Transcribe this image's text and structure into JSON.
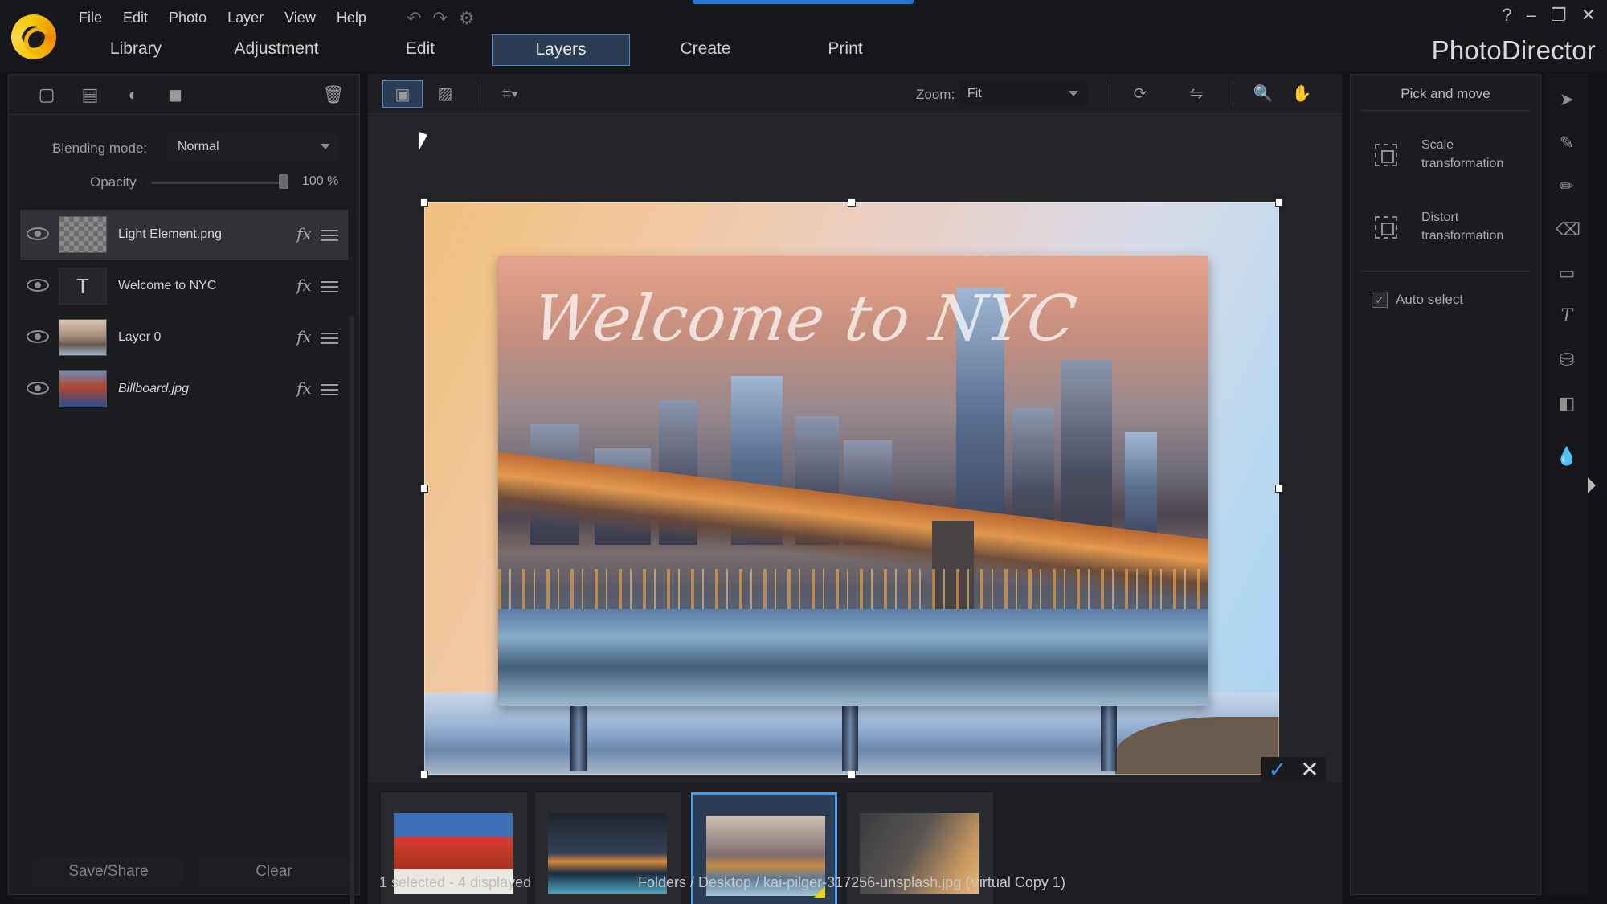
{
  "menu": [
    "File",
    "Edit",
    "Photo",
    "Layer",
    "View",
    "Help"
  ],
  "window_controls": {
    "help": "?",
    "minimize": "–",
    "restore": "❐",
    "close": "✕"
  },
  "tabs": [
    {
      "label": "Library"
    },
    {
      "label": "Adjustment"
    },
    {
      "label": "Edit"
    },
    {
      "label": "Layers"
    },
    {
      "label": "Create"
    },
    {
      "label": "Print"
    }
  ],
  "active_tab": "Layers",
  "brand": "PhotoDirector",
  "accent_color": "#1f7ad6",
  "layer_panel": {
    "blending_label": "Blending mode:",
    "blending_value": "Normal",
    "opacity_label": "Opacity",
    "opacity_value": "100 %",
    "opacity_fraction": 1.0,
    "layers": [
      {
        "name": "Light Element.png",
        "selected": true,
        "fx": "fx"
      },
      {
        "name": "Welcome to NYC",
        "thumb_text": "T",
        "fx": "fx"
      },
      {
        "name": "Layer 0",
        "fx": "fx"
      },
      {
        "name": "Billboard.jpg",
        "fx": "fx"
      }
    ],
    "save_share": "Save/Share",
    "clear": "Clear"
  },
  "toolbar": {
    "zoom_label": "Zoom:",
    "zoom_value": "Fit"
  },
  "canvas": {
    "billboard_text": "Welcome to NYC",
    "confirm": "✓",
    "cancel": "✕"
  },
  "status": {
    "selection": "1 selected - 4 displayed",
    "path": "Folders / Desktop / kai-pilger-317256-unsplash.jpg (Virtual Copy 1)"
  },
  "right_panel": {
    "title": "Pick and move",
    "scale": "Scale\ntransformation",
    "distort": "Distort\ntransformation",
    "auto_select": "Auto select",
    "auto_select_checked": true
  }
}
